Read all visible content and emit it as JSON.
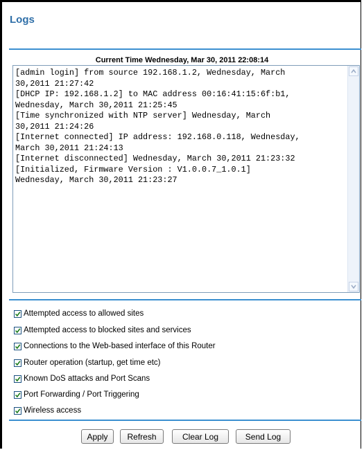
{
  "page": {
    "title": "Logs",
    "current_time": "Current Time Wednesday, Mar 30, 2011 22:08:14",
    "accent_color": "#2f6fa8",
    "rule_color": "#3b8fd0"
  },
  "log": {
    "text": "[admin login] from source 192.168.1.2, Wednesday, March\n30,2011 21:27:42\n[DHCP IP: 192.168.1.2] to MAC address 00:16:41:15:6f:b1,\nWednesday, March 30,2011 21:25:45\n[Time synchronized with NTP server] Wednesday, March\n30,2011 21:24:26\n[Internet connected] IP address: 192.168.0.118, Wednesday,\nMarch 30,2011 21:24:13\n[Internet disconnected] Wednesday, March 30,2011 21:23:32\n[Initialized, Firmware Version : V1.0.0.7_1.0.1]\nWednesday, March 30,2011 21:23:27",
    "scroll_up_icon": "arrow-up-icon",
    "scroll_down_icon": "arrow-down-icon"
  },
  "options": [
    {
      "label": "Attempted access to allowed sites",
      "checked": true
    },
    {
      "label": "Attempted access to blocked sites and services",
      "checked": true
    },
    {
      "label": "Connections to the Web-based interface of this Router",
      "checked": true
    },
    {
      "label": "Router operation (startup, get time etc)",
      "checked": true
    },
    {
      "label": "Known DoS attacks and Port Scans",
      "checked": true
    },
    {
      "label": "Port Forwarding / Port Triggering",
      "checked": true
    },
    {
      "label": "Wireless access",
      "checked": true
    }
  ],
  "buttons": {
    "apply": "Apply",
    "refresh": "Refresh",
    "clear_log": "Clear Log",
    "send_log": "Send Log"
  }
}
